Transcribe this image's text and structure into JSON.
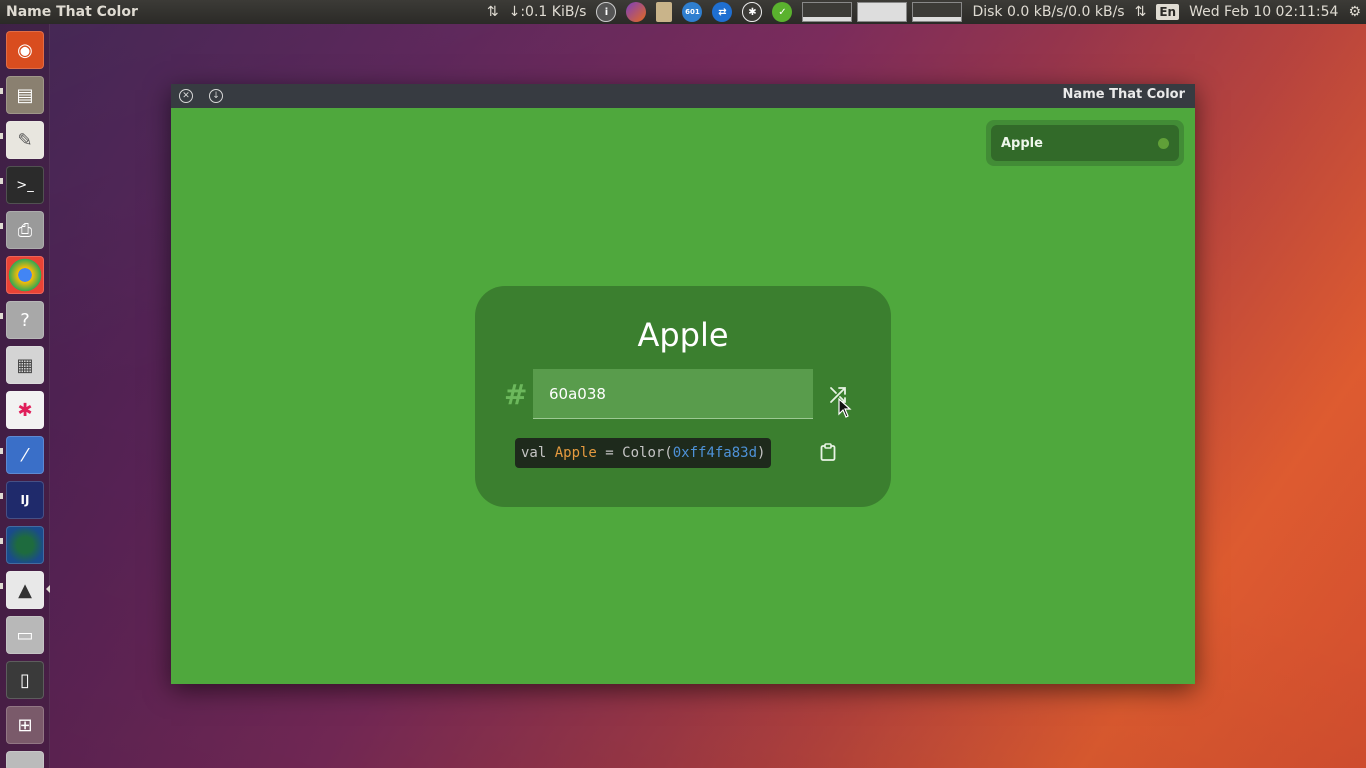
{
  "top_panel": {
    "app_title": "Name That Color",
    "net_speed": "↓:0.1 KiB/s",
    "disk_speed": "Disk 0.0 kB/s/0.0 kB/s",
    "keyboard_layout": "En",
    "datetime": "Wed Feb 10 02:11:54"
  },
  "launcher": {
    "items": [
      "ubuntu-dash",
      "files",
      "text-editor",
      "terminal",
      "printer",
      "chrome",
      "help",
      "calculator",
      "slack",
      "color-picker",
      "intellij-idea",
      "web-browser",
      "inkscape",
      "disk",
      "android-device",
      "workspace-switcher",
      "trash"
    ]
  },
  "window": {
    "title": "Name That Color",
    "background_color": "#4fa83d",
    "recent_chip": {
      "label": "Apple",
      "dot_color": "#60a038"
    },
    "card": {
      "color_name": "Apple",
      "hash_symbol": "#",
      "hex_value": "60a038",
      "code_keyword": "val ",
      "code_name": "Apple",
      "code_eq": " = Color(",
      "code_hex": "0xff4fa83d",
      "code_close": ")"
    }
  },
  "colors": {
    "accent_green": "#4fa83d",
    "card_green": "#3b7f2f",
    "code_name_orange": "#e59a3f",
    "code_hex_blue": "#4e92d8"
  }
}
